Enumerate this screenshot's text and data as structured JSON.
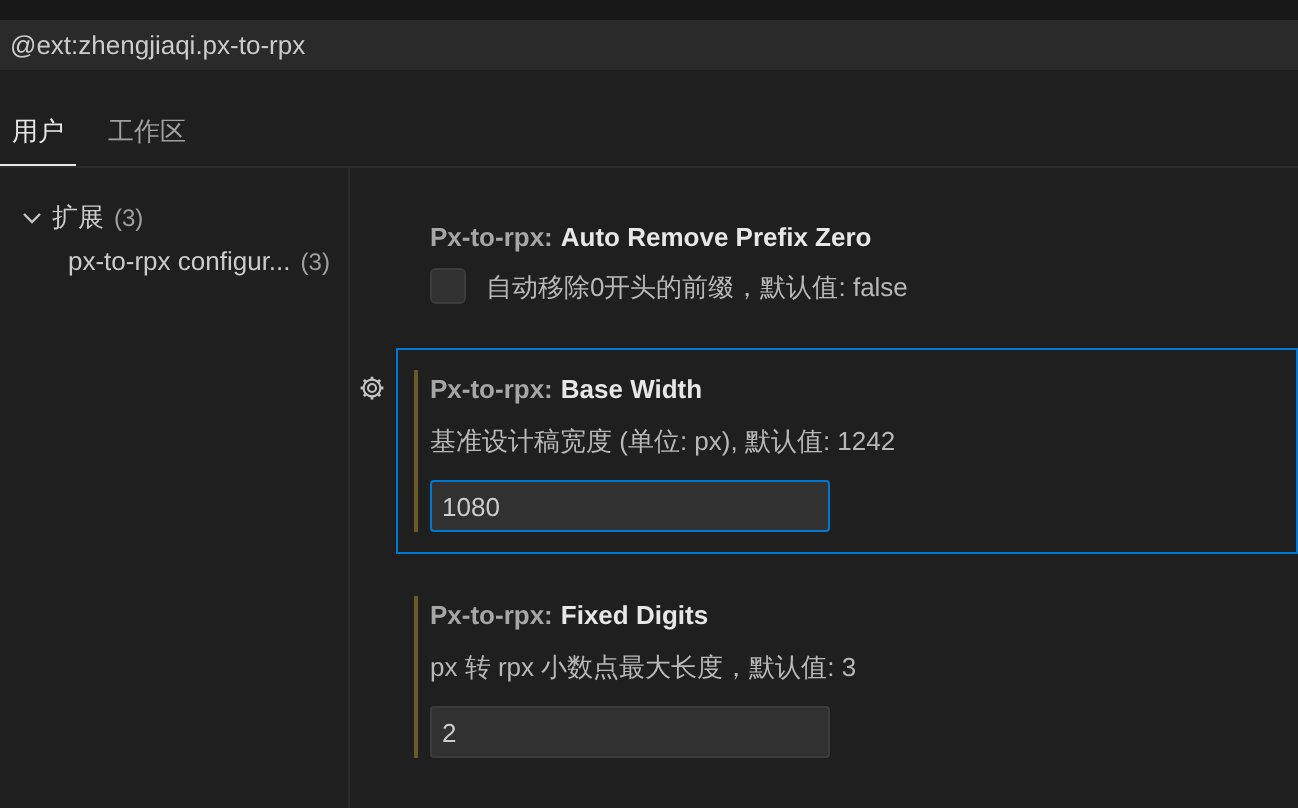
{
  "search": {
    "value": "@ext:zhengjiaqi.px-to-rpx"
  },
  "tabs": [
    {
      "label": "用户",
      "selected": true
    },
    {
      "label": "工作区",
      "selected": false
    }
  ],
  "sidebar": {
    "items": [
      {
        "label": "扩展",
        "count": "(3)",
        "expanded": true,
        "children": [
          {
            "label": "px-to-rpx configur...",
            "count": "(3)"
          }
        ]
      }
    ]
  },
  "settings": [
    {
      "kind": "checkbox",
      "category": "Px-to-rpx:",
      "title": "Auto Remove Prefix Zero",
      "description": "自动移除0开头的前缀，默认值: false",
      "checked": false,
      "modified": false,
      "focused": false
    },
    {
      "kind": "number",
      "category": "Px-to-rpx:",
      "title": "Base Width",
      "description": "基准设计稿宽度 (单位: px), 默认值: 1242",
      "value": "1080",
      "modified": true,
      "focused": true
    },
    {
      "kind": "number",
      "category": "Px-to-rpx:",
      "title": "Fixed Digits",
      "description": "px 转 rpx 小数点最大长度，默认值: 3",
      "value": "2",
      "modified": true,
      "focused": false
    }
  ]
}
